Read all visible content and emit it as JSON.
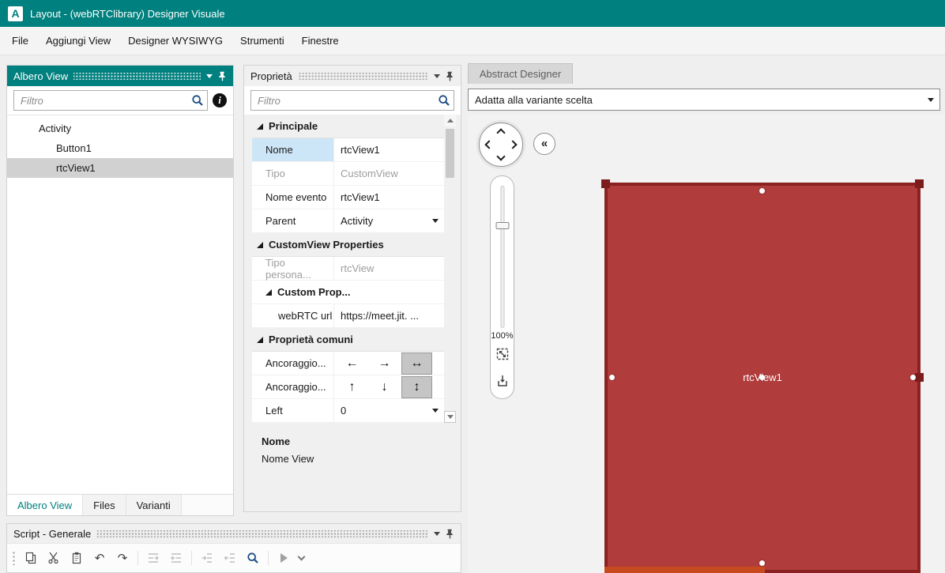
{
  "window": {
    "app_initial": "A",
    "title": "Layout - (webRTClibrary) Designer Visuale"
  },
  "menu_bar": {
    "items": [
      "File",
      "Aggiungi View",
      "Designer WYSIWYG",
      "Strumenti",
      "Finestre"
    ]
  },
  "icons": {
    "info": "i",
    "undo": "↶",
    "redo": "↷",
    "back": "«"
  },
  "tree_panel": {
    "title": "Albero View",
    "filter_placeholder": "Filtro",
    "nodes": [
      {
        "label": "Activity"
      },
      {
        "label": "Button1"
      },
      {
        "label": "rtcView1"
      }
    ],
    "tabs": [
      "Albero View",
      "Files",
      "Varianti"
    ]
  },
  "properties_panel": {
    "title": "Proprietà",
    "filter_placeholder": "Filtro",
    "sections": {
      "principale": "Principale",
      "customview": "CustomView Properties",
      "custom_props": "Custom Prop...",
      "comuni": "Proprietà comuni"
    },
    "props": {
      "nome": {
        "label": "Nome",
        "value": "rtcView1"
      },
      "tipo": {
        "label": "Tipo",
        "value": "CustomView"
      },
      "nome_evento": {
        "label": "Nome evento",
        "value": "rtcView1"
      },
      "parent": {
        "label": "Parent",
        "value": "Activity"
      },
      "tipo_personalizzato": {
        "label": "Tipo persona...",
        "value": "rtcView"
      },
      "webrtc_url": {
        "label": "webRTC url",
        "value": "https://meet.jit. ..."
      },
      "ancoraggio_h": {
        "label": "Ancoraggio...",
        "arrows": [
          "←",
          "→",
          "↔"
        ]
      },
      "ancoraggio_v": {
        "label": "Ancoraggio...",
        "arrows": [
          "↑",
          "↓",
          "↕"
        ]
      },
      "left": {
        "label": "Left",
        "value": "0"
      }
    },
    "description": {
      "title": "Nome",
      "text": "Nome View"
    }
  },
  "designer": {
    "tab": "Abstract Designer",
    "variant_selector": "Adatta alla variante scelta",
    "zoom": "100%",
    "view_label": "rtcView1"
  },
  "script_panel": {
    "title": "Script - Generale"
  },
  "colors": {
    "accent_teal": "#00807E",
    "view_fill": "#B13C3C",
    "view_border": "#8B2121",
    "selection_blue": "#CDE6F7",
    "bottom_accent": "#C64A1E"
  }
}
